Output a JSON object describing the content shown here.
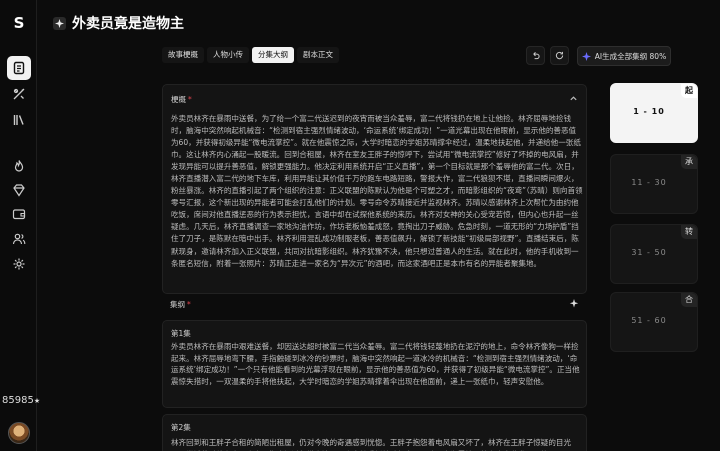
{
  "app": {
    "logo": "S"
  },
  "rail": {
    "credits_value": "85985",
    "credits_unit": "★"
  },
  "page": {
    "title": "外卖员竟是造物主"
  },
  "tabs": [
    {
      "label": "故事梗概",
      "active": false
    },
    {
      "label": "人物小传",
      "active": false
    },
    {
      "label": "分集大纲",
      "active": true
    },
    {
      "label": "剧本正文",
      "active": false
    }
  ],
  "toolbar": {
    "generate_label": "AI生成全部集纲 80%"
  },
  "outline": {
    "label": "梗概",
    "text": "外卖员林齐在暴雨中送餐，为了给一个富二代送迟到的夜宵而被当众羞辱，富二代将钱扔在地上让他捡。林齐屈辱地捡钱时，脑海中突然响起机械音：“检测到宿主强烈情绪波动，‘命运系统’绑定成功！”一道光幕出现在他眼前，显示他的善恶值为60，并获得初级异能“微电流掌控”。就在他震惊之际，大学时暗恋的学姐苏晴撑伞经过，温柔地扶起他，并递给他一张纸巾。这让林齐内心涌起一股暖流。回到合租屋，林齐在室友王胖子的惊呼下，尝试用“微电流掌控”修好了坏掉的电风扇，并发现异能可以提升善恶值，解锁更强能力。他决定利用系统开启“正义直播”，第一个目标就是那个羞辱他的富二代。次日，林齐直播潜入富二代的地下车库，利用异能让其价值千万的跑车电路短路，警报大作，富二代狼狈不堪，直播间瞬间爆火，粉丝暴涨。林齐的直播引起了两个组织的注意：正义联盟的陈默认为他是个可塑之才，而暗影组织的“夜鸢”（苏晴）则向首领零号汇报，这个新出现的异能者可能会打乱他们的计划。零号命令苏晴接近并监视林齐。苏晴以感谢林齐上次帮忙为由约他吃饭，席间对他直播惩恶的行为表示担忧，言语中却在试探他系统的来历。林齐对女神的关心受宠若惊，但内心也升起一丝疑虑。几天后，林齐直播调查一家地沟油作坊，作坊老板恼羞成怒，竟掏出刀子威胁。危急时刻，一道无形的“力场护盾”挡住了刀子，是陈默在暗中出手。林齐利用混乱成功制服老板，善恶值飙升，解锁了新技能“初级局部视野”。直播结束后，陈默现身，邀请林齐加入正义联盟，共同对抗暗影组织。林齐犹豫不决，他只想过普通人的生活。就在此时，他的手机收到一条匿名短信，附着一张照片：苏晴正走进一家名为“异次元”的酒吧，而这家酒吧正是本市有名的异能者聚集地。"
  },
  "episodes": {
    "label": "集纲",
    "items": [
      {
        "title": "第1集",
        "text": "外卖员林齐在暴雨中艰难送餐，却因送达超时被富二代当众羞辱。富二代将钱轻蔑地扔在泥泞的地上，命令林齐像狗一样捡起来。林齐屈辱地弯下腰，手指触碰到冰冷的钞票时，脑海中突然响起一道冰冷的机械音：“检测到宿主强烈情绪波动，‘命运系统’绑定成功！”一个只有他能看到的光幕浮现在眼前，显示他的善恶值为60，并获得了初级异能“微电流掌控”。正当他震惊失措时，一双温柔的手将他扶起，大学时暗恋的学姐苏晴撑着伞出现在他面前，递上一张纸巾，轻声安慰他。"
      },
      {
        "title": "第2集",
        "text": "林齐回到和王胖子合租的简陋出租屋，仍对今晚的奇遇感到恍惚。王胖子抱怨着电风扇又坏了，林齐在王胖子惊疑的目光下，尝试将手放在电风扇上，指尖闪过细微电流，风扇竟然重新转动起来。王胖子大为震惊，林齐也由此发现异能可以"
      }
    ]
  },
  "episode_nav": [
    {
      "tag": "起",
      "range": "1 - 10",
      "active": true
    },
    {
      "tag": "承",
      "range": "11 - 30",
      "active": false
    },
    {
      "tag": "转",
      "range": "31 - 50",
      "active": false
    },
    {
      "tag": "合",
      "range": "51 - 60",
      "active": false
    }
  ],
  "colors": {
    "accent": "#6b6cff",
    "required": "#e0444e",
    "background": "#0c0c0c"
  }
}
